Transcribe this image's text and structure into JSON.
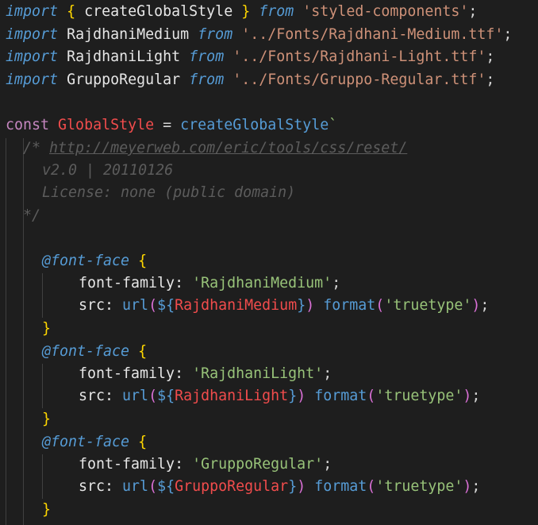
{
  "editor": {
    "lines": {
      "l1": {
        "kw": "import",
        "lb": "{",
        "name": "createGlobalStyle",
        "rb": "}",
        "from": "from",
        "src": "'styled-components'",
        "semi": ";"
      },
      "l2": {
        "kw": "import",
        "name": "RajdhaniMedium",
        "from": "from",
        "src": "'../Fonts/Rajdhani-Medium.ttf'",
        "semi": ";"
      },
      "l3": {
        "kw": "import",
        "name": "RajdhaniLight",
        "from": "from",
        "src": "'../Fonts/Rajdhani-Light.ttf'",
        "semi": ";"
      },
      "l4": {
        "kw": "import",
        "name": "GruppoRegular",
        "from": "from",
        "src": "'../Fonts/Gruppo-Regular.ttf'",
        "semi": ";"
      },
      "l6": {
        "kw": "const",
        "name": "GlobalStyle",
        "eq": "=",
        "fn": "createGlobalStyle",
        "tick": "`"
      },
      "l7": {
        "open": "/* ",
        "url": "http://meyerweb.com/eric/tools/css/reset/"
      },
      "l8": {
        "text": "v2.0 | 20110126"
      },
      "l9": {
        "text": "License: none (public domain)"
      },
      "l10": {
        "text": "*/"
      },
      "ff1": {
        "at": "@font-face",
        "lb": "{",
        "family_prop": "font-family:",
        "family_val": "'RajdhaniMedium'",
        "semi": ";",
        "src_prop": "src:",
        "url": "url",
        "dollar": "${",
        "var": "RajdhaniMedium",
        "close": "}",
        "format": "format",
        "fmt_val": "'truetype'",
        "rb": "}"
      },
      "ff2": {
        "at": "@font-face",
        "lb": "{",
        "family_prop": "font-family:",
        "family_val": "'RajdhaniLight'",
        "semi": ";",
        "src_prop": "src:",
        "url": "url",
        "dollar": "${",
        "var": "RajdhaniLight",
        "close": "}",
        "format": "format",
        "fmt_val": "'truetype'",
        "rb": "}"
      },
      "ff3": {
        "at": "@font-face",
        "lb": "{",
        "family_prop": "font-family:",
        "family_val": "'GruppoRegular'",
        "semi": ";",
        "src_prop": "src:",
        "url": "url",
        "dollar": "${",
        "var": "GruppoRegular",
        "close": "}",
        "format": "format",
        "fmt_val": "'truetype'",
        "rb": "}"
      }
    },
    "punct": {
      "lparen": "(",
      "rparen": ")",
      "semi": ";",
      "space": " "
    },
    "colors": {
      "background": "#1e1e1e",
      "keyword": "#569cd6",
      "string": "#ce9178",
      "brace": "#ffd700",
      "paren": "#da70d6",
      "variable": "#f14c4c",
      "comment": "#5c5c5c"
    }
  }
}
